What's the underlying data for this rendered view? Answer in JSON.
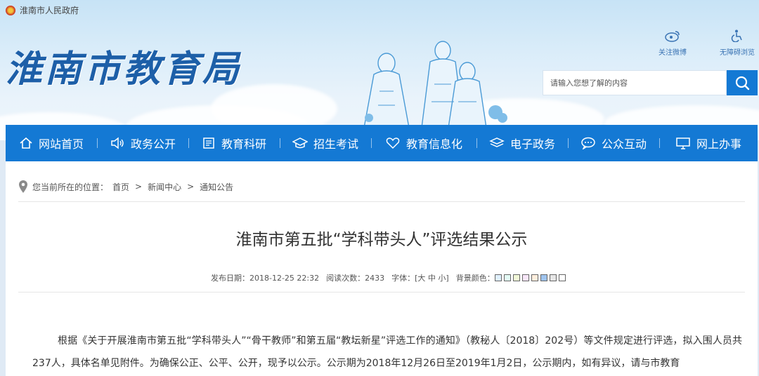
{
  "header": {
    "gov_link": "淮南市人民政府",
    "site_title": "淮南市教育局",
    "tools": [
      {
        "label": "关注微博",
        "icon": "weibo-icon"
      },
      {
        "label": "无障碍浏览",
        "icon": "accessibility-icon"
      }
    ],
    "search": {
      "placeholder": "请输入您想了解的内容",
      "icon": "search-icon"
    }
  },
  "nav": {
    "items": [
      {
        "label": "网站首页",
        "icon": "home-icon"
      },
      {
        "label": "政务公开",
        "icon": "speaker-icon"
      },
      {
        "label": "教育科研",
        "icon": "document-icon"
      },
      {
        "label": "招生考试",
        "icon": "graduation-cap-icon"
      },
      {
        "label": "教育信息化",
        "icon": "heart-icon"
      },
      {
        "label": "电子政务",
        "icon": "layers-icon"
      },
      {
        "label": "公众互动",
        "icon": "chat-icon"
      },
      {
        "label": "网上办事",
        "icon": "monitor-icon"
      }
    ]
  },
  "breadcrumb": {
    "prefix": "您当前所在的位置：",
    "items": [
      "首页",
      "新闻中心",
      "通知公告"
    ],
    "separator": ">"
  },
  "article": {
    "title": "淮南市第五批“学科带头人”评选结果公示",
    "meta": {
      "publish_label": "发布日期：",
      "publish_date": "2018-12-25 22:32",
      "views_label": "阅读次数：",
      "views": "2433",
      "font_label": "字体：",
      "font_options": "[大 中 小]",
      "bg_label": "背景颜色：",
      "bg_colors": [
        "#dff0ff",
        "#e3fbf5",
        "#f2f9d8",
        "#f8e6f9",
        "#ffeedd",
        "#9fc4ef",
        "#e6e6e6",
        "#ffffff"
      ]
    },
    "body": "根据《关于开展淮南市第五批“学科带头人”“骨干教师”和第五届“教坛新星”评选工作的通知》（教秘人〔2018〕202号）等文件规定进行评选，拟入围人员共237人，具体名单见附件。为确保公正、公平、公开，现予以公示。公示期为2018年12月26日至2019年1月2日，公示期内，如有异议，请与市教育"
  },
  "colors": {
    "nav_bg": "#1479d4",
    "title_blue": "#1d5fa8"
  }
}
